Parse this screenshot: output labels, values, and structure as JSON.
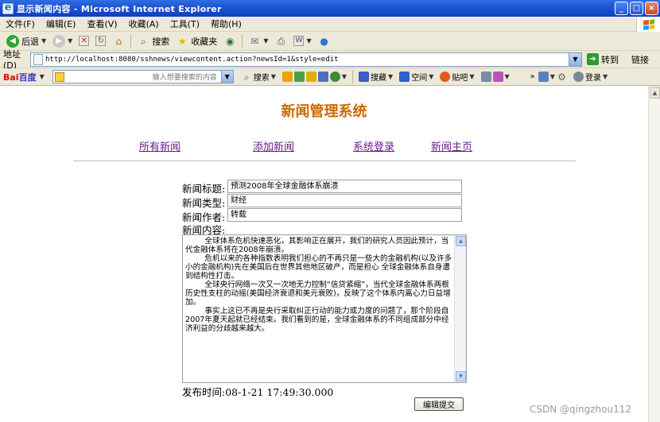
{
  "window": {
    "title": "显示新闻内容 - Microsoft Internet Explorer",
    "buttons": {
      "minimize": "_",
      "maximize": "□",
      "close": "×"
    }
  },
  "menu": [
    "文件(F)",
    "编辑(E)",
    "查看(V)",
    "收藏(A)",
    "工具(T)",
    "帮助(H)"
  ],
  "toolbar": {
    "back": "后退",
    "search": "搜索",
    "favorites": "收藏夹"
  },
  "address": {
    "label": "地址(D)",
    "url": "http://localhost:8080/sshnews/viewcontent.action?newsId=1&style=edit",
    "go": "转到",
    "links": "链接"
  },
  "baidu": {
    "logo_part1": "Bai",
    "logo_part2": "百度",
    "placeholder": "输入想要搜索的内容",
    "search": "搜索",
    "bookmark": "搜藏",
    "space": "空间",
    "tieba": "贴吧",
    "login": "登录"
  },
  "page": {
    "site_title": "新闻管理系统",
    "nav": [
      "所有新闻",
      "添加新闻",
      "系统登录",
      "新闻主页"
    ],
    "labels": {
      "title": "新闻标题:",
      "type": "新闻类型:",
      "author": "新闻作者:",
      "content": "新闻内容:"
    },
    "values": {
      "title": "预测2008年全球金融体系崩溃",
      "type": "财经",
      "author": "转载",
      "content": "        全球体系危机快速恶化，其影响正在展开，我们的研究人员因此预计，当代金融体系将在2008年崩溃。\n        危机以来的各种指数表明我们担心的不再只是一些大的金融机构(以及许多小的金融机构)先在美国后在世界其他地区破产，而是担心 全球金融体系自身遭到结构性打击。\n        全球央行网络一次又一次地无力控制“信贷紧缩”，当代全球金融体系两根历史性支柱的动摇(美国经济衰退和美元衰败)，反映了这个体系内离心力日益增加。\n        事实上这已不再是央行采取纠正行动的能力或力度的问题了，那个阶段自2007年夏天起就已经结束。我们看到的是，全球金融体系的不同组成部分中经济利益的分歧越来越大。"
    },
    "publish_time": "发布时间:08-1-21 17:49:30.000",
    "submit": "编辑提交",
    "watermark": "CSDN @qingzhou112"
  },
  "colors": {
    "title_bar": "#1f55d2",
    "site_title": "#c96a00",
    "nav_link": "#6a1a8a",
    "chrome": "#ece9d8"
  }
}
